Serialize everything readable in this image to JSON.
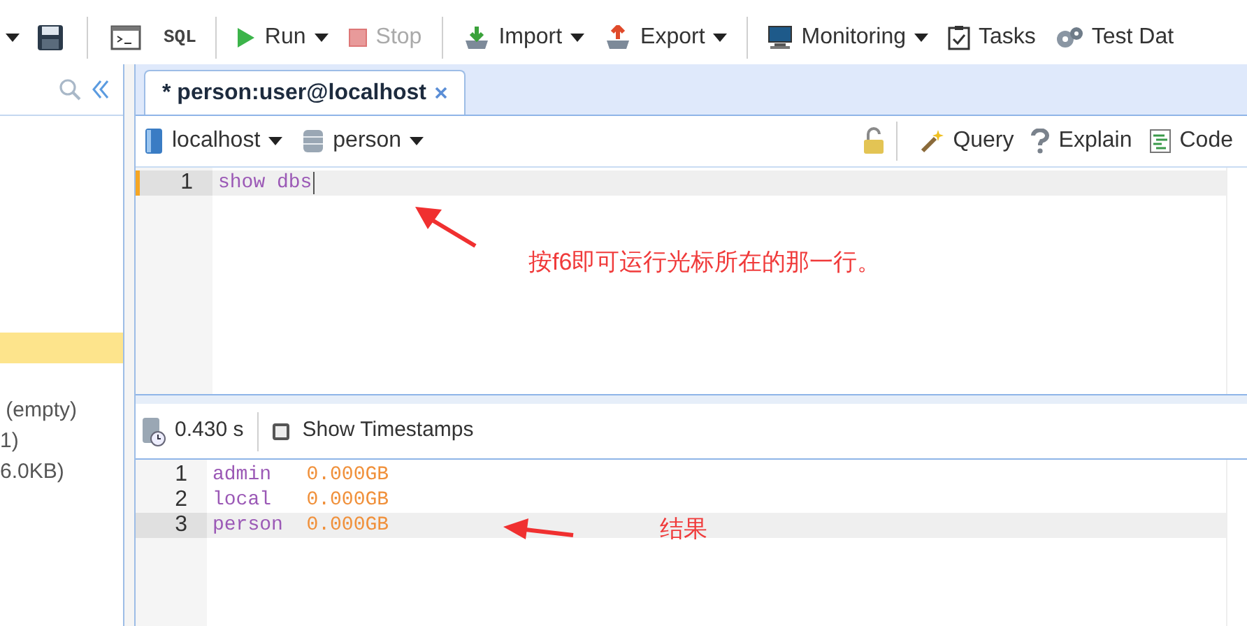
{
  "toolbar": [
    {
      "kind": "caret"
    },
    {
      "kind": "icon"
    },
    {
      "kind": "separator"
    },
    {
      "kind": "icon"
    },
    {
      "kind": "text",
      "label": "SQL"
    },
    {
      "kind": "separator"
    },
    {
      "kind": "button",
      "label": "Run",
      "dropdown": true,
      "disabled": false
    },
    {
      "kind": "button",
      "label": "Stop",
      "dropdown": false,
      "disabled": true
    },
    {
      "kind": "separator"
    },
    {
      "kind": "button",
      "label": "Import",
      "dropdown": true,
      "disabled": false
    },
    {
      "kind": "button",
      "label": "Export",
      "dropdown": true,
      "disabled": false
    },
    {
      "kind": "separator"
    },
    {
      "kind": "button",
      "label": "Monitoring",
      "dropdown": true,
      "disabled": false
    },
    {
      "kind": "button",
      "label": "Tasks",
      "dropdown": false,
      "disabled": false
    },
    {
      "kind": "button",
      "label": "Test Dat",
      "dropdown": false,
      "disabled": false
    }
  ],
  "sidebar": {
    "rows": [
      {
        "selected": true
      },
      {
        "text": " (empty)",
        "selected": false
      },
      {
        "text": "1)",
        "selected": false
      },
      {
        "text": "6.0KB)",
        "selected": false
      }
    ]
  },
  "tabs": [
    {
      "label": "* person:user@localhost",
      "selected": true
    }
  ],
  "editor_toolbar": {
    "server": "localhost",
    "database": "person",
    "actions": [
      "Query",
      "Explain",
      "Code"
    ]
  },
  "editor": {
    "lines": [
      {
        "number": "1",
        "text": "show dbs",
        "current": true
      }
    ]
  },
  "results_toolbar": {
    "time": "0.430 s",
    "show_timestamps": {
      "label": "Show Timestamps",
      "checked": false
    }
  },
  "results": {
    "lines": [
      {
        "number": "1",
        "name": "admin ",
        "size": "0.000GB",
        "current": false
      },
      {
        "number": "2",
        "name": "local ",
        "size": "0.000GB",
        "current": false
      },
      {
        "number": "3",
        "name": "person",
        "size": "0.000GB",
        "current": true
      }
    ]
  },
  "annotations": [
    {
      "text": "按f6即可运行光标所在的那一行。"
    },
    {
      "text": "结果"
    }
  ]
}
